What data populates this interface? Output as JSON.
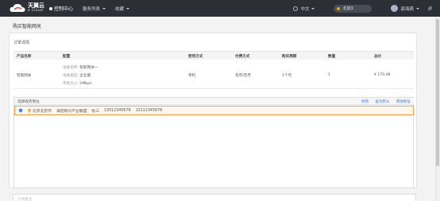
{
  "topbar": {
    "logo_main": "天翼云",
    "logo_sub": "e Cloud",
    "console": "控制中心",
    "nav": [
      {
        "label": "服务列表"
      },
      {
        "label": "收藏"
      }
    ],
    "language": "中文",
    "region": "北京3",
    "username": "邵海燕"
  },
  "page": {
    "title": "购买智能网关",
    "section_title": "订单详情"
  },
  "order_table": {
    "headers": [
      "产品名称",
      "配置",
      "使用方式",
      "付费方式",
      "购买周期",
      "数量",
      "总价"
    ],
    "row": {
      "product": "智能网关",
      "config": [
        {
          "key": "设备名称:",
          "value": "智能网关一"
        },
        {
          "key": "设备类型:",
          "value": "企业版"
        },
        {
          "key": "带宽大小:",
          "value": "2Mbps"
        }
      ],
      "usage": "单机",
      "payment": "包年/包月",
      "period": "1个月",
      "quantity": "1",
      "total": "¥ 170.48"
    }
  },
  "address": {
    "title": "选择收货地址",
    "actions": [
      "修改",
      "设为默认",
      "添加地址"
    ],
    "selected": {
      "city": "北京北京市",
      "street": "海淀新兴产业联盟",
      "name": "张三",
      "phone1": "13012345678",
      "phone2": "13112345678"
    }
  },
  "remark": {
    "placeholder": "订单备注"
  },
  "colors": {
    "topbar": "#2c2f36",
    "accent": "#3a7bd5",
    "selected_border": "#f0a04b",
    "region_pin": "#e8a317"
  }
}
